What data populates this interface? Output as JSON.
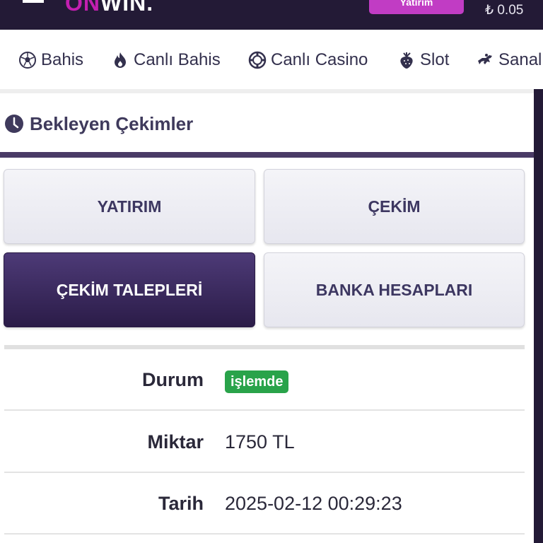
{
  "header": {
    "logo_part1": "ON",
    "logo_part2": "WIN.",
    "deposit_label": "Yatırım",
    "balance": "₺ 0.05"
  },
  "nav": {
    "items": [
      {
        "label": "Bahis",
        "icon": "soccer-ball-icon"
      },
      {
        "label": "Canlı Bahis",
        "icon": "fire-icon"
      },
      {
        "label": "Canlı Casino",
        "icon": "casino-chip-icon"
      },
      {
        "label": "Slot",
        "icon": "strawberry-icon"
      },
      {
        "label": "Sanal",
        "icon": "horse-racing-icon"
      }
    ]
  },
  "section": {
    "title": "Bekleyen Çekimler",
    "icon": "clock-icon"
  },
  "tiles": [
    {
      "label": "YATIRIM",
      "active": false
    },
    {
      "label": "ÇEKİM",
      "active": false
    },
    {
      "label": "ÇEKİM TALEPLERİ",
      "active": true
    },
    {
      "label": "BANKA HESAPLARI",
      "active": false
    }
  ],
  "details": {
    "status_label": "Durum",
    "status_value": "işlemde",
    "amount_label": "Miktar",
    "amount_value": "1750 TL",
    "date_label": "Tarih",
    "date_value": "2025-02-12 00:29:23"
  },
  "colors": {
    "header_bg": "#231a36",
    "accent": "#c13cc4",
    "active_tile": "#3b2a60",
    "status_badge": "#29a34a"
  }
}
